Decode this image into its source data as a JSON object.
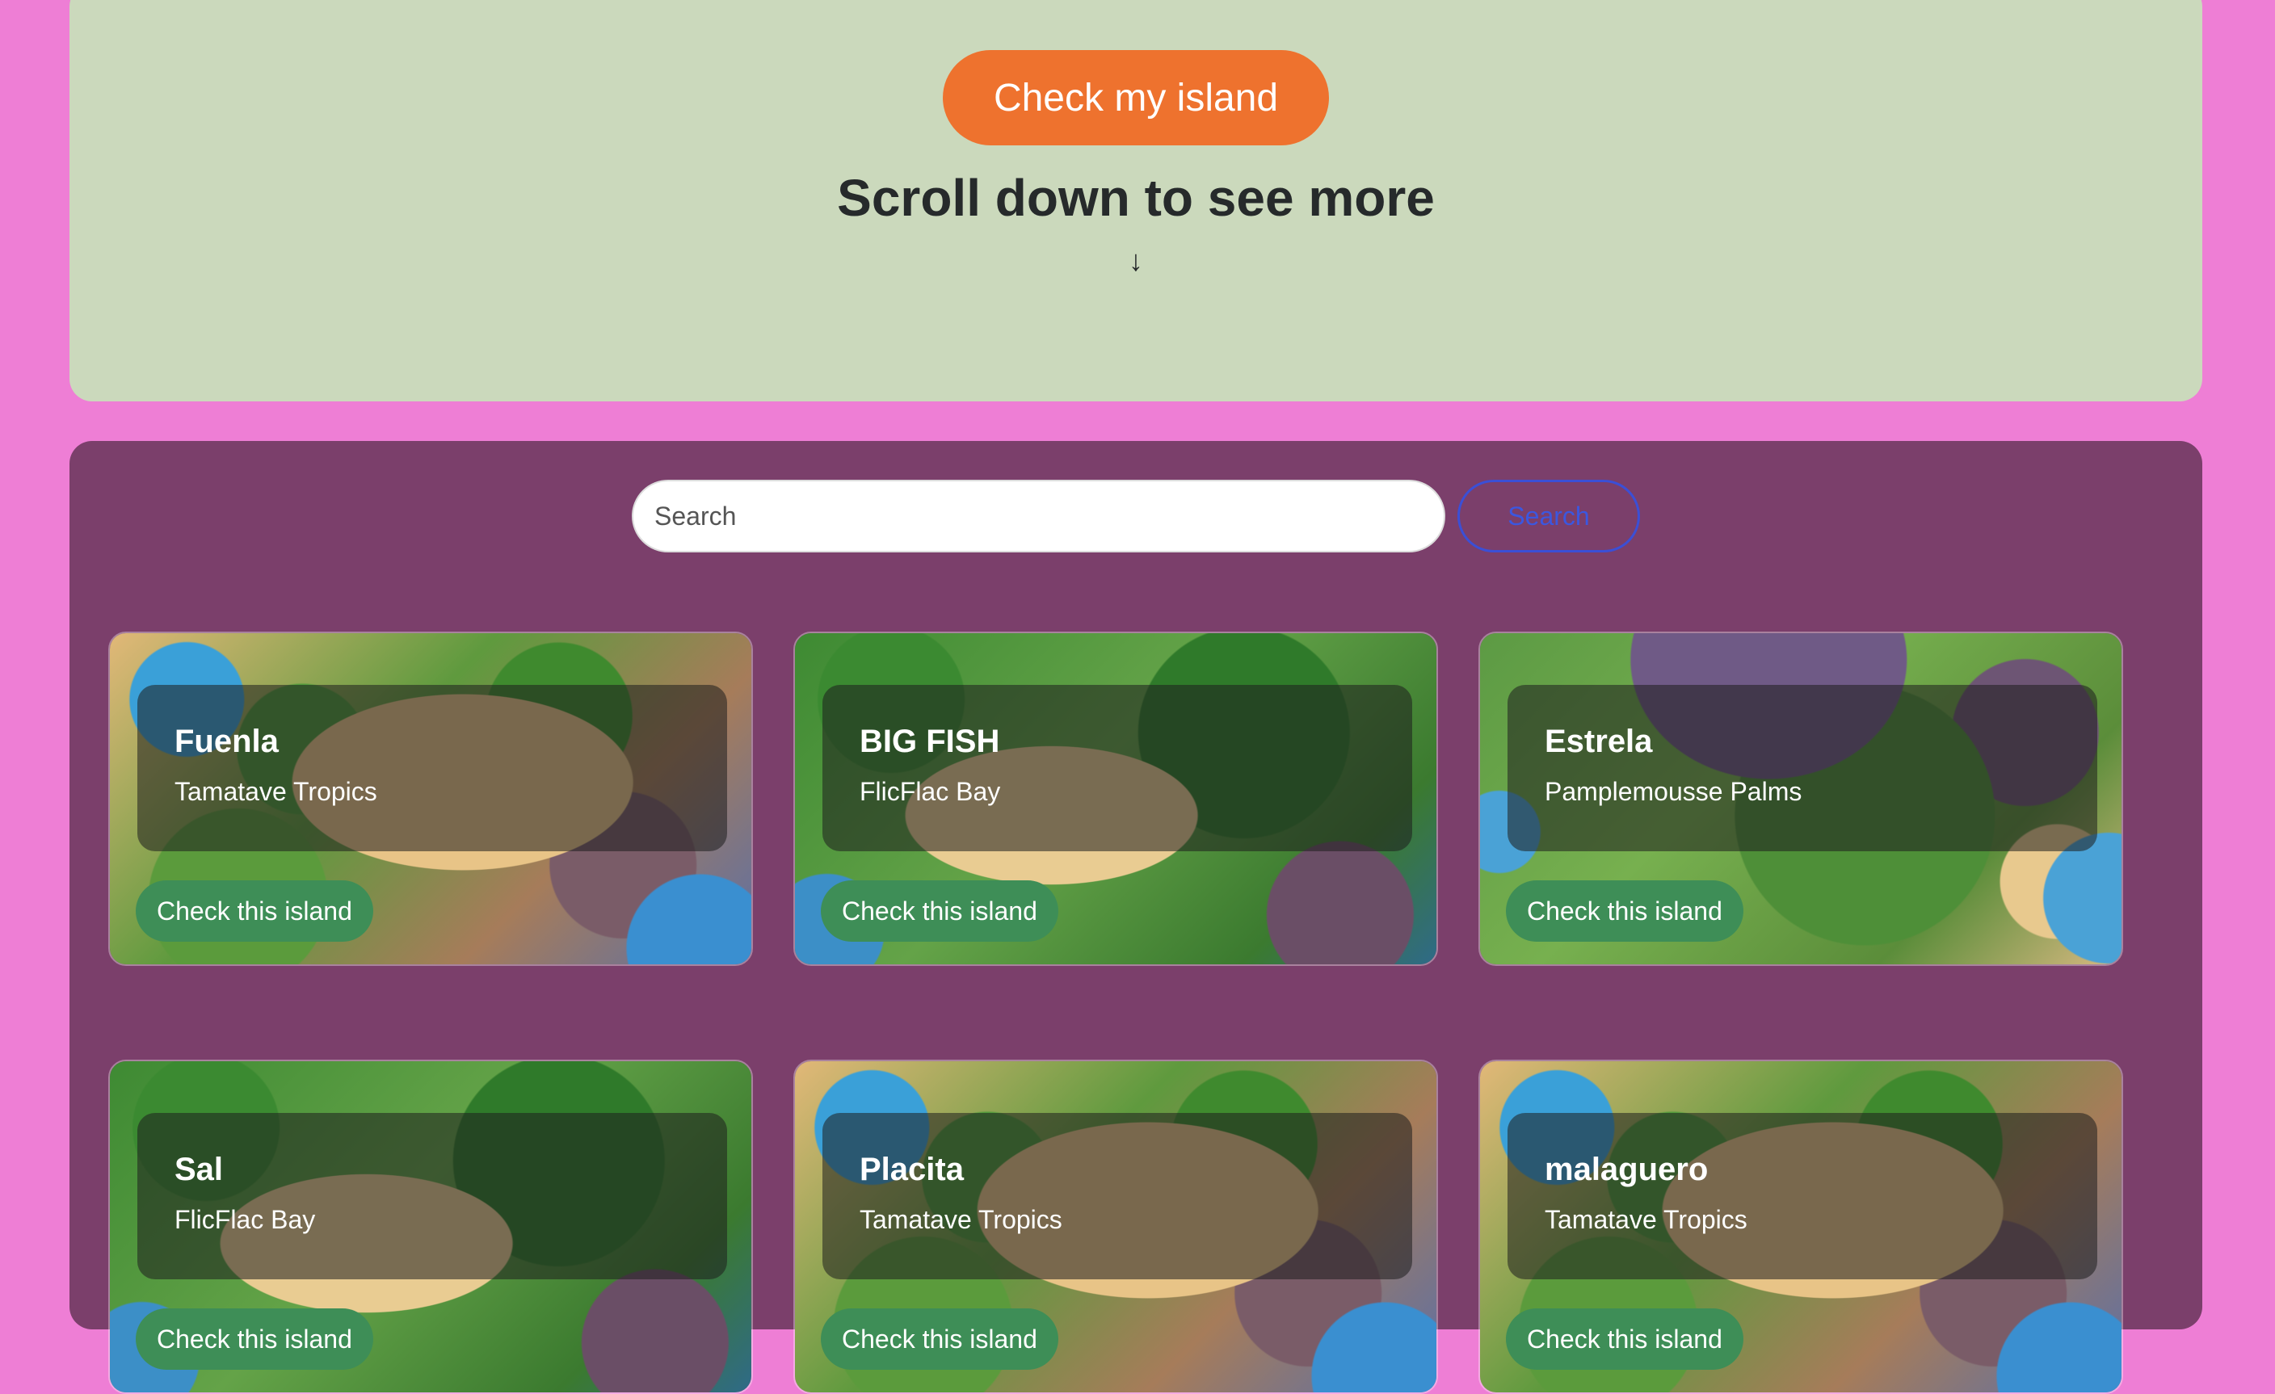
{
  "hero": {
    "button_label": "Check my island",
    "title": "Scroll down to see more",
    "arrow": "↓"
  },
  "search": {
    "placeholder": "Search",
    "button_label": "Search"
  },
  "colors": {
    "page_bg": "#ee7ed5",
    "hero_bg": "#cbd9bc",
    "hero_button": "#ee722e",
    "panel_bg": "#7b3f6b",
    "search_button_border": "#3b4fd6",
    "card_button": "#3e8e57"
  },
  "islands": [
    {
      "name": "Fuenla",
      "region": "Tamatave Tropics",
      "button_label": "Check this island",
      "image": "island-thumbnail"
    },
    {
      "name": "BIG FISH",
      "region": "FlicFlac Bay",
      "button_label": "Check this island",
      "image": "island-thumbnail"
    },
    {
      "name": "Estrela",
      "region": "Pamplemousse Palms",
      "button_label": "Check this island",
      "image": "island-thumbnail"
    },
    {
      "name": "Sal",
      "region": "FlicFlac Bay",
      "button_label": "Check this island",
      "image": "island-thumbnail"
    },
    {
      "name": "Placita",
      "region": "Tamatave Tropics",
      "button_label": "Check this island",
      "image": "island-thumbnail"
    },
    {
      "name": "malaguero",
      "region": "Tamatave Tropics",
      "button_label": "Check this island",
      "image": "island-thumbnail"
    }
  ]
}
